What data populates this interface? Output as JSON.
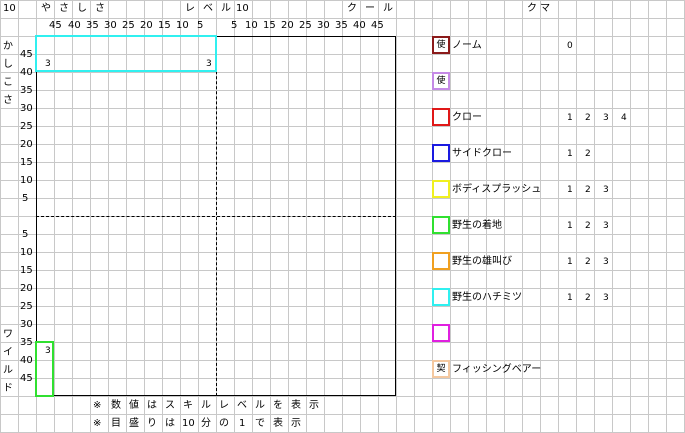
{
  "corner": "10",
  "top": {
    "left_title": [
      "や",
      "さ",
      "し",
      "さ"
    ],
    "left_level": [
      "レ",
      "ベ",
      "ル"
    ],
    "level_num": "10",
    "right_title": [
      "ク",
      "ー",
      "ル"
    ],
    "left_ticks": [
      "45",
      "40",
      "35",
      "30",
      "25",
      "20",
      "15",
      "10",
      "5"
    ],
    "right_ticks": [
      "5",
      "10",
      "15",
      "20",
      "25",
      "30",
      "35",
      "40",
      "45"
    ]
  },
  "left": {
    "upper_title": [
      "か",
      "し",
      "こ",
      "さ"
    ],
    "lower_title": [
      "ワ",
      "イ",
      "ル",
      "ド"
    ],
    "upper_ticks": [
      "45",
      "40",
      "35",
      "30",
      "25",
      "20",
      "15",
      "10",
      "5"
    ],
    "lower_ticks": [
      "5",
      "10",
      "15",
      "20",
      "25",
      "30",
      "35",
      "40",
      "45"
    ]
  },
  "markers": {
    "cyan_left": "3",
    "cyan_right": "3",
    "green": "3"
  },
  "notes": [
    [
      "※",
      "数",
      "値",
      "は",
      "ス",
      "キ",
      "ル",
      "レ",
      "ベ",
      "ル",
      "を",
      "表",
      "示"
    ],
    [
      "※",
      "目",
      "盛",
      "り",
      "は",
      "10",
      "分",
      "の",
      "1",
      "で",
      "表",
      "示"
    ]
  ],
  "legend": {
    "header": "ク マ",
    "items": [
      {
        "label": "ノーム",
        "icon_text": "使",
        "color": "#8b1a1a",
        "levels": [
          "0"
        ]
      },
      {
        "label": "",
        "icon_text": "使",
        "color": "#c58ae6",
        "levels": []
      },
      {
        "label": "クロー",
        "icon_text": "",
        "color": "#e01818",
        "levels": [
          "1",
          "2",
          "3",
          "4"
        ]
      },
      {
        "label": "サイドクロー",
        "icon_text": "",
        "color": "#1a1ae0",
        "levels": [
          "1",
          "2"
        ]
      },
      {
        "label": "ボディスプラッシュ",
        "icon_text": "",
        "color": "#f0f020",
        "levels": [
          "1",
          "2",
          "3"
        ]
      },
      {
        "label": "野生の着地",
        "icon_text": "",
        "color": "#30e030",
        "levels": [
          "1",
          "2",
          "3"
        ]
      },
      {
        "label": "野生の雄叫び",
        "icon_text": "",
        "color": "#f0a020",
        "levels": [
          "1",
          "2",
          "3"
        ]
      },
      {
        "label": "野生のハチミツ",
        "icon_text": "",
        "color": "#30f0f0",
        "levels": [
          "1",
          "2",
          "3"
        ]
      },
      {
        "label": "",
        "icon_text": "",
        "color": "#e020e0",
        "levels": []
      },
      {
        "label": "フィッシングベアー",
        "icon_text": "契",
        "color": "#f4c8a0",
        "levels": []
      }
    ]
  }
}
